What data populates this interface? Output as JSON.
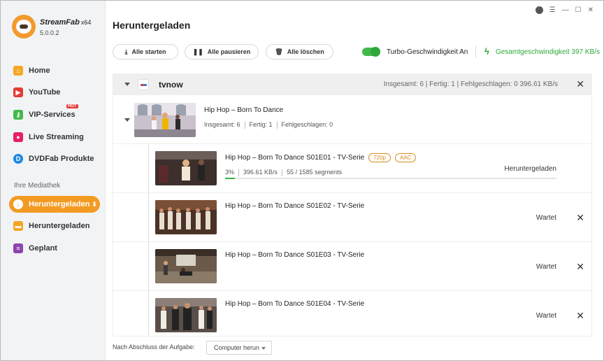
{
  "app": {
    "name": "StreamFab",
    "arch": "x64",
    "version": "5.0.0.2"
  },
  "sidebar": {
    "items": [
      {
        "label": "Home",
        "icon": "home-icon",
        "color": "#f5a623"
      },
      {
        "label": "YouTube",
        "icon": "youtube-icon",
        "color": "#e53935"
      },
      {
        "label": "VIP-Services",
        "icon": "key-icon",
        "color": "#43b94a",
        "badge": "HOT"
      },
      {
        "label": "Live Streaming",
        "icon": "live-icon",
        "color": "#e91e63"
      },
      {
        "label": "DVDFab Produkte",
        "icon": "dvdfab-icon",
        "color": "#1e88e5"
      }
    ],
    "library_title": "Ihre Mediathek",
    "library": [
      {
        "label": "Heruntergeladen",
        "icon": "download-icon",
        "active": true
      },
      {
        "label": "Heruntergeladen",
        "icon": "folder-icon",
        "color": "#f5a623"
      },
      {
        "label": "Geplant",
        "icon": "list-icon",
        "color": "#8e44ad"
      }
    ]
  },
  "header": {
    "title": "Heruntergeladen",
    "buttons": {
      "start_all": "Alle starten",
      "pause_all": "Alle pausieren",
      "delete_all": "Alle löschen"
    },
    "turbo_label": "Turbo-Geschwindigkeit An",
    "turbo_on": true,
    "total_speed": "Gesamtgeschwindigkeit 397 KB/s"
  },
  "group": {
    "site": "tvnow",
    "stats": "Insgesamt: 6 | Fertig: 1 | Fehlgeschlagen: 0     396.61 KB/s",
    "series": {
      "title": "Hip Hop – Born To Dance",
      "total": "Insgesamt:  6",
      "done": "Fertig:  1",
      "failed": "Fehlgeschlagen: 0"
    },
    "episodes": [
      {
        "title": "Hip Hop – Born To Dance S01E01 - TV-Serie",
        "quality": "720p",
        "audio": "AAC",
        "percent": "3%",
        "progress": 0.03,
        "speed": "396.61 KB/s",
        "segments": "55 / 1585 segments",
        "status": "Heruntergeladen"
      },
      {
        "title": "Hip Hop – Born To Dance S01E02 - TV-Serie",
        "status": "Wartet"
      },
      {
        "title": "Hip Hop – Born To Dance S01E03 - TV-Serie",
        "status": "Wartet"
      },
      {
        "title": "Hip Hop – Born To Dance S01E04 - TV-Serie",
        "status": "Wartet"
      }
    ]
  },
  "footer": {
    "label": "Nach Abschluss der Aufgabe:",
    "select_value": "Computer herun"
  }
}
